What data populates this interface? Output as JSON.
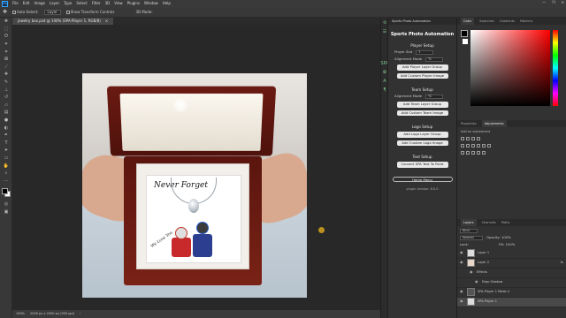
{
  "app": {
    "logo": "Ps",
    "window_controls": [
      "—",
      "❐",
      "✕"
    ]
  },
  "menu": [
    "File",
    "Edit",
    "Image",
    "Layer",
    "Type",
    "Select",
    "Filter",
    "3D",
    "View",
    "Plugins",
    "Window",
    "Help"
  ],
  "options": {
    "auto_select": "Auto-Select:",
    "layer": "Layer",
    "transform": "Show Transform Controls",
    "mode3d": "3D Mode:"
  },
  "document": {
    "tab": "jewelry box.psd @ 100% (SPA-Player 1, RGB/8)",
    "close": "×"
  },
  "status": {
    "zoom": "100%",
    "size": "2000 px x 2000 px (300 ppi)"
  },
  "plugin": {
    "tab": "Sports Photo Automation",
    "title": "Sports Photo Automation",
    "player": {
      "title": "Player Setup",
      "slot_label": "Player Slot",
      "slot_value": "1",
      "align_label": "Alignment Mode",
      "align_value": "TC",
      "btn1": "Add Player Layer Group",
      "btn2": "Add Custom Player Image"
    },
    "team": {
      "title": "Team Setup",
      "align_label": "Alignment Mode",
      "align_value": "TC",
      "btn1": "Add Team Layer Group",
      "btn2": "Add Custom Team Image"
    },
    "logo": {
      "title": "Logo Setup",
      "btn1": "Add Logo Layer Group",
      "btn2": "Add Custom Logo Image"
    },
    "text": {
      "title": "Text Setup",
      "btn1": "Convert SPA Text To Point"
    },
    "home": "Home Menu",
    "version": "plugin version: 8.0.0"
  },
  "color_panel": {
    "tabs": [
      "Color",
      "Swatches",
      "Gradients",
      "Patterns"
    ]
  },
  "adjust_panel": {
    "tabs": [
      "Properties",
      "Adjustments"
    ],
    "hint": "Add an adjustment"
  },
  "layers_panel": {
    "tabs": [
      "Layers",
      "Channels",
      "Paths"
    ],
    "kind": "Kind",
    "blend": "Normal",
    "opacity": "Opacity: 100%",
    "fill": "Fill: 100%",
    "lock": "Lock:",
    "rows": [
      {
        "name": "Layer 1",
        "fx": ""
      },
      {
        "name": "Layer 2",
        "fx": "fx"
      },
      {
        "name": "Effects",
        "fx": ""
      },
      {
        "name": "Drop Shadow",
        "fx": ""
      },
      {
        "name": "SPA-Player 1 Mode 4",
        "fx": ""
      },
      {
        "name": "SPA-Player 1",
        "fx": ""
      }
    ]
  },
  "card": {
    "headline": "Never Forget",
    "signature": "We Love You"
  }
}
